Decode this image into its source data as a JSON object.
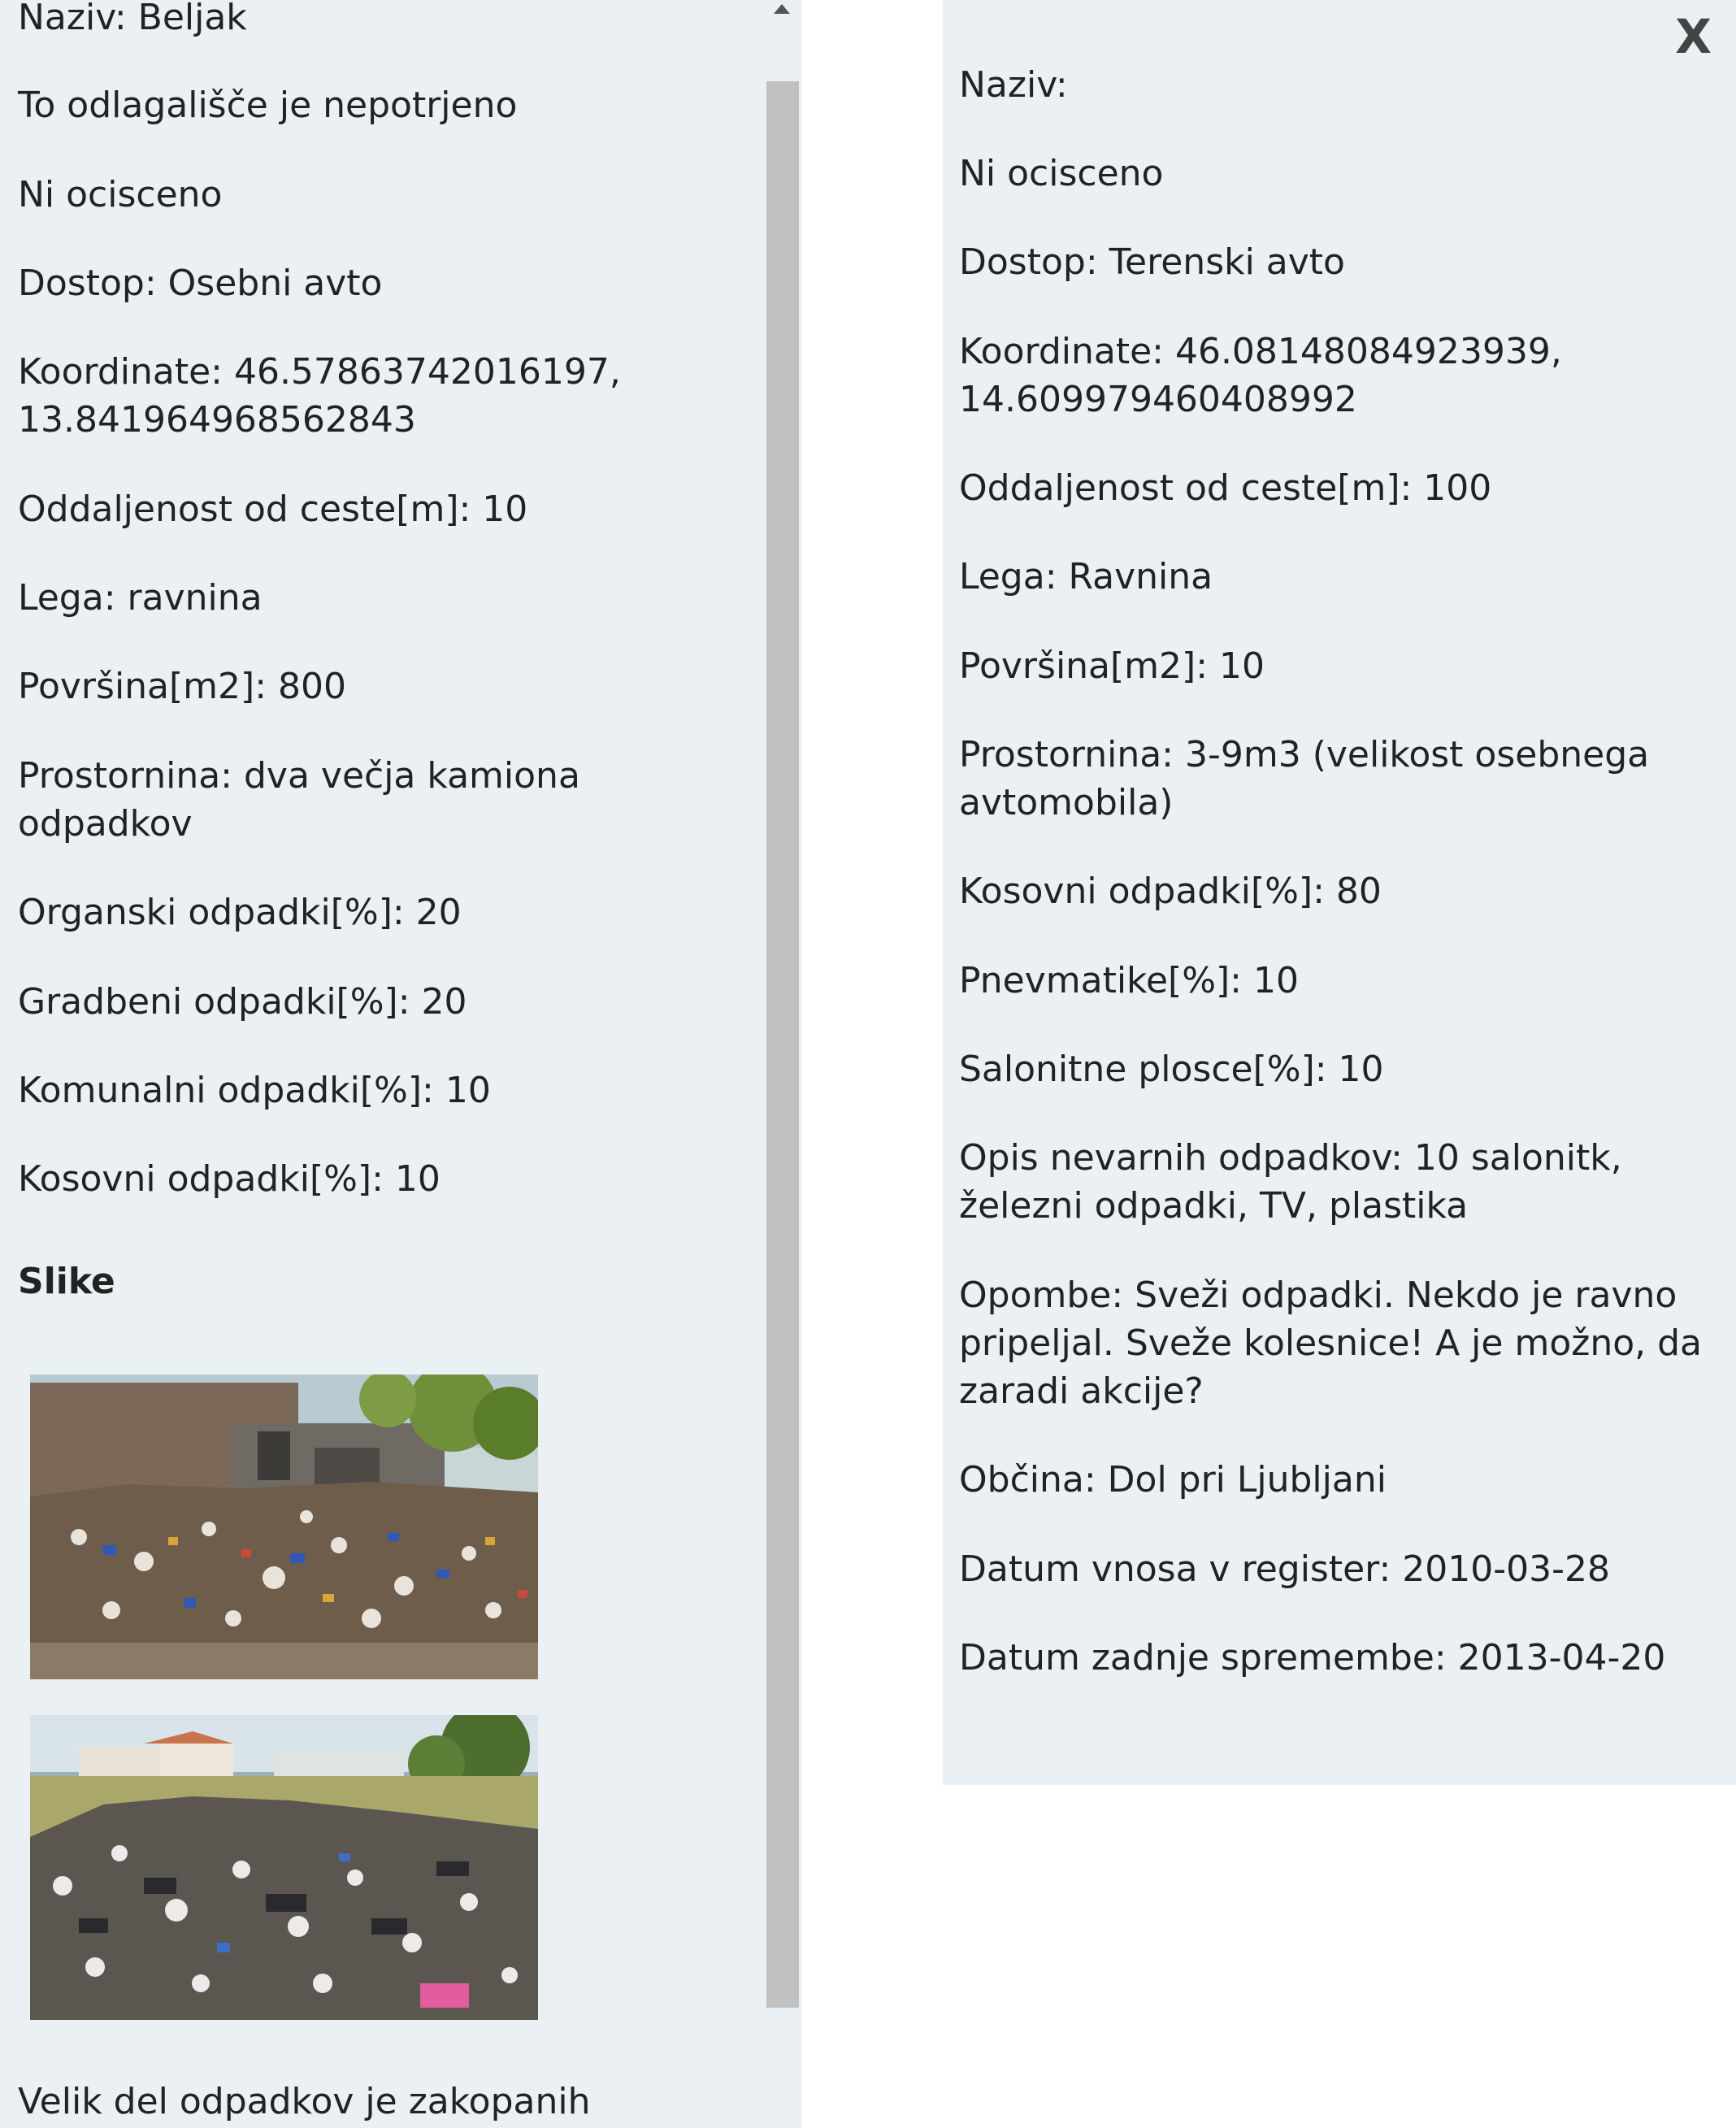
{
  "left_panel": {
    "lines": [
      "Naziv: Beljak",
      "To odlagališče je nepotrjeno",
      "Ni ocisceno",
      "Dostop: Osebni avto",
      "Koordinate: 46.57863742016197,",
      "13.841964968562843",
      "Oddaljenost od ceste[m]: 10",
      "Lega: ravnina",
      "Površina[m2]: 800",
      "Prostornina: dva večja kamiona",
      "odpadkov",
      "Organski odpadki[%]: 20",
      "Gradbeni odpadki[%]: 20",
      "Komunalni odpadki[%]: 10",
      "Kosovni odpadki[%]: 10"
    ],
    "images_heading": "Slike",
    "photos": [
      "garbage-dump-photo",
      "garbage-dump-photo"
    ],
    "caption": "Velik del odpadkov je zakopanih"
  },
  "right_panel": {
    "close_label": "X",
    "lines": [
      "Naziv:",
      "Ni ocisceno",
      "Dostop: Terenski avto",
      "Koordinate: 46.08148084923939,",
      "14.609979460408992",
      "Oddaljenost od ceste[m]: 100",
      "Lega: Ravnina",
      "Površina[m2]: 10",
      "Prostornina: 3-9m3 (velikost osebnega",
      "avtomobila)",
      "Kosovni odpadki[%]: 80",
      "Pnevmatike[%]: 10",
      "Salonitne plosce[%]: 10",
      "Opis nevarnih odpadkov: 10 salonitk,",
      "železni odpadki, TV, plastika",
      "Opombe: Sveži odpadki. Nekdo je ravno",
      "pripeljal. Sveže kolesnice! A je možno, da",
      "zaradi akcije?",
      "Občina: Dol pri Ljubljani",
      "Datum vnosa v register: 2010-03-28",
      "Datum zadnje spremembe: 2013-04-20"
    ]
  },
  "colors": {
    "panel_bg": "#eaf0f3",
    "text": "#222222",
    "scrollbar_thumb": "#c1c1c1"
  }
}
